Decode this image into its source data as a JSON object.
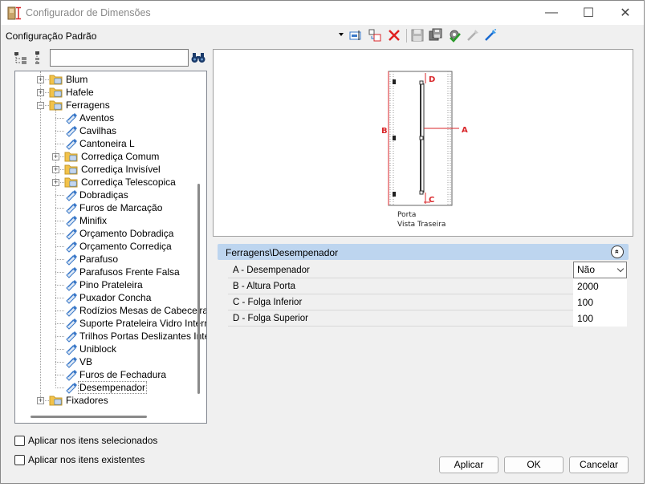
{
  "window": {
    "title": "Configurador de Dimensões",
    "min_symbol": "—",
    "max_symbol": "☐",
    "close_symbol": "✕"
  },
  "toolbar": {
    "config_label": "Configuração Padrão"
  },
  "search": {
    "value": ""
  },
  "tree": {
    "items": [
      {
        "label": "Blum",
        "level": 1,
        "type": "folder",
        "expander": "+"
      },
      {
        "label": "Hafele",
        "level": 1,
        "type": "folder",
        "expander": "+"
      },
      {
        "label": "Ferragens",
        "level": 1,
        "type": "folder",
        "expander": "−"
      },
      {
        "label": "Aventos",
        "level": 2,
        "type": "item"
      },
      {
        "label": "Cavilhas",
        "level": 2,
        "type": "item"
      },
      {
        "label": "Cantoneira L",
        "level": 2,
        "type": "item"
      },
      {
        "label": "Corrediça Comum",
        "level": 2,
        "type": "folder",
        "expander": "+"
      },
      {
        "label": "Corrediça Invisível",
        "level": 2,
        "type": "folder",
        "expander": "+"
      },
      {
        "label": "Corrediça Telescopica",
        "level": 2,
        "type": "folder",
        "expander": "+"
      },
      {
        "label": "Dobradiças",
        "level": 2,
        "type": "item"
      },
      {
        "label": "Furos de Marcação",
        "level": 2,
        "type": "item"
      },
      {
        "label": "Minifix",
        "level": 2,
        "type": "item"
      },
      {
        "label": "Orçamento Dobradiça",
        "level": 2,
        "type": "item"
      },
      {
        "label": "Orçamento Corrediça",
        "level": 2,
        "type": "item"
      },
      {
        "label": "Parafuso",
        "level": 2,
        "type": "item"
      },
      {
        "label": "Parafusos Frente Falsa",
        "level": 2,
        "type": "item"
      },
      {
        "label": "Pino Prateleira",
        "level": 2,
        "type": "item"
      },
      {
        "label": "Puxador Concha",
        "level": 2,
        "type": "item"
      },
      {
        "label": "Rodízios Mesas de Cabeceira",
        "level": 2,
        "type": "item"
      },
      {
        "label": "Suporte Prateleira Vidro Interno",
        "level": 2,
        "type": "item"
      },
      {
        "label": "Trilhos Portas Deslizantes Internas",
        "level": 2,
        "type": "item"
      },
      {
        "label": "Uniblock",
        "level": 2,
        "type": "item"
      },
      {
        "label": "VB",
        "level": 2,
        "type": "item"
      },
      {
        "label": "Furos de Fechadura",
        "level": 2,
        "type": "item"
      },
      {
        "label": "Desempenador",
        "level": 2,
        "type": "item",
        "selected": true
      },
      {
        "label": "Fixadores",
        "level": 1,
        "type": "folder",
        "expander": "+"
      }
    ]
  },
  "preview": {
    "label_a": "A",
    "label_b": "B",
    "label_c": "C",
    "label_d": "D",
    "caption_line1": "Porta",
    "caption_line2": "Vista Traseira"
  },
  "properties": {
    "header": "Ferragens\\Desempenador",
    "collapse_symbol": "«",
    "rows": [
      {
        "label": "A - Desempenador",
        "value": "Não",
        "type": "select"
      },
      {
        "label": "B - Altura Porta",
        "value": "2000",
        "type": "text"
      },
      {
        "label": "C - Folga Inferior",
        "value": "100",
        "type": "text"
      },
      {
        "label": "D - Folga Superior",
        "value": "100",
        "type": "text"
      }
    ]
  },
  "options": {
    "apply_selected": "Aplicar nos itens selecionados",
    "apply_existing": "Aplicar nos itens existentes"
  },
  "buttons": {
    "apply": "Aplicar",
    "ok": "OK",
    "cancel": "Cancelar"
  },
  "colors": {
    "accent_red": "#d9262a",
    "header_bg": "#bdd5ef",
    "folder_yellow": "#f2c24a",
    "icon_blue": "#3a78c8"
  }
}
